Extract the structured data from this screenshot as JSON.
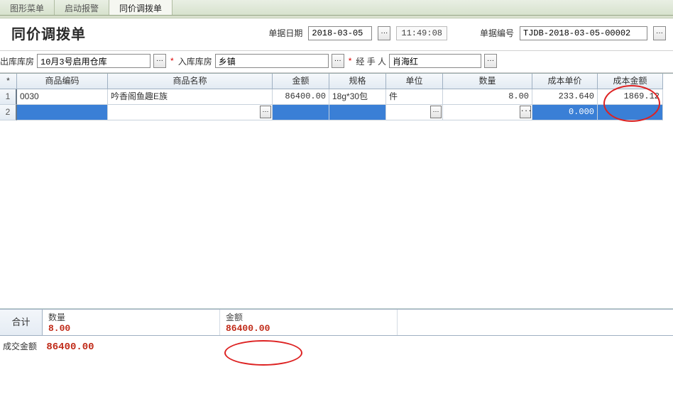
{
  "tabs": {
    "t0": "图形菜单",
    "t1": "启动报警",
    "t2": "同价调拨单"
  },
  "title": "同价调拨单",
  "header": {
    "date_label": "单据日期",
    "date_value": "2018-03-05",
    "time_value": "11:49:08",
    "docno_label": "单据编号",
    "docno_value": "TJDB-2018-03-05-00002"
  },
  "filters": {
    "out_label": "出库库房",
    "out_value": "10月3号启用仓库",
    "in_label": "入库库房",
    "in_value": "乡镇",
    "handler_label": "经 手 人",
    "handler_value": "肖海红"
  },
  "columns": {
    "c1": "商品编码",
    "c2": "商品名称",
    "c3": "金额",
    "c4": "规格",
    "c5": "单位",
    "c6": "数量",
    "c7": "成本单价",
    "c8": "成本金额"
  },
  "rows": [
    {
      "n": "1",
      "code": "0030",
      "name": "吟香阁鱼趣E族",
      "amount": "86400.00",
      "spec": "18g*30包",
      "unit": "件",
      "qty": "8.00",
      "cost_price": "233.640",
      "cost_amt": "1869.12"
    },
    {
      "n": "2",
      "code": "",
      "name": "",
      "amount": "",
      "spec": "",
      "unit": "",
      "qty": "",
      "cost_price": "0.000",
      "cost_amt": ""
    }
  ],
  "totals": {
    "label": "合计",
    "qty_label": "数量",
    "qty_value": "8.00",
    "amt_label": "金额",
    "amt_value": "86400.00"
  },
  "deal": {
    "label": "成交金额",
    "value": "86400.00"
  },
  "glyphs": {
    "ellipsis": "···",
    "star": "*"
  }
}
